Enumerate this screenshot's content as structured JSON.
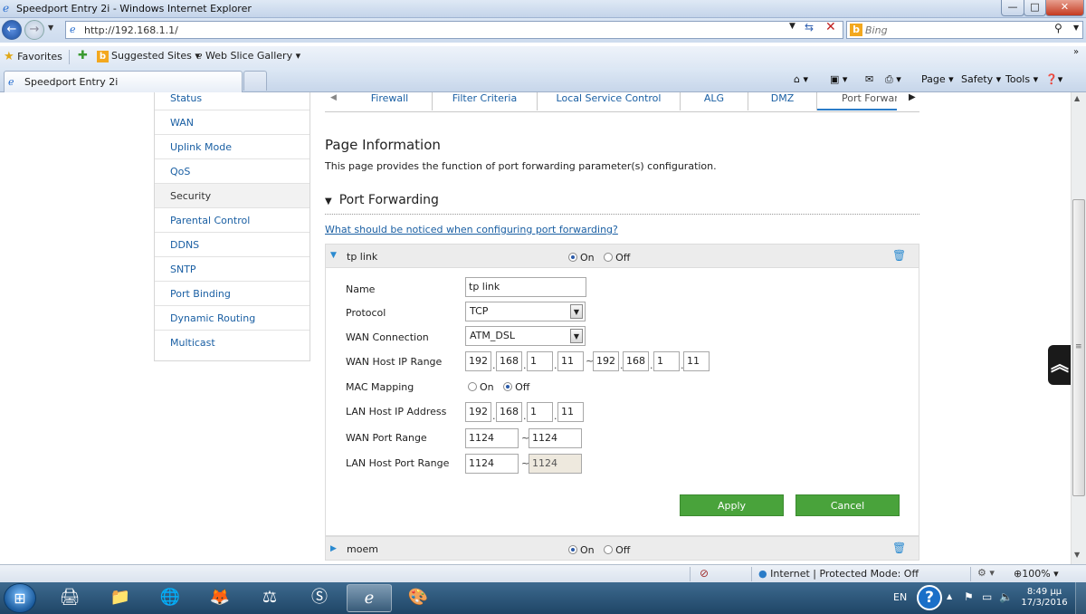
{
  "window": {
    "title": "Speedport Entry 2i - Windows Internet Explorer",
    "controls": {
      "minimize": "—",
      "maximize": "□",
      "close": "✕"
    }
  },
  "addressbar": {
    "url": "http://192.168.1.1/",
    "search_placeholder": "Bing"
  },
  "favorites": {
    "favorites_label": "Favorites",
    "suggested_label": "Suggested Sites ▾",
    "webslice_label": "Web Slice Gallery ▾"
  },
  "tabs": {
    "active_label": "Speedport Entry 2i"
  },
  "commandbar": {
    "page": "Page ▾",
    "safety": "Safety ▾",
    "tools": "Tools ▾"
  },
  "sidebar": {
    "items": [
      {
        "label": "Status"
      },
      {
        "label": "WAN"
      },
      {
        "label": "Uplink Mode"
      },
      {
        "label": "QoS"
      },
      {
        "label": "Security"
      },
      {
        "label": "Parental Control"
      },
      {
        "label": "DDNS"
      },
      {
        "label": "SNTP"
      },
      {
        "label": "Port Binding"
      },
      {
        "label": "Dynamic Routing"
      },
      {
        "label": "Multicast"
      }
    ],
    "active_index": 4
  },
  "subtabs": {
    "items": [
      {
        "label": "Firewall"
      },
      {
        "label": "Filter Criteria"
      },
      {
        "label": "Local Service Control"
      },
      {
        "label": "ALG"
      },
      {
        "label": "DMZ"
      },
      {
        "label": "Port Forwarc"
      }
    ],
    "active_index": 5
  },
  "page": {
    "title": "Page Information",
    "description": "This page provides the function of port forwarding parameter(s) configuration.",
    "section_title": "Port Forwarding",
    "help_link": "What should be noticed when configuring port forwarding?"
  },
  "rules": [
    {
      "name": "tp link",
      "on_label": "On",
      "off_label": "Off",
      "enabled": true,
      "expanded": true,
      "fields": {
        "name_label": "Name",
        "name_value": "tp  link",
        "protocol_label": "Protocol",
        "protocol_value": "TCP",
        "wan_conn_label": "WAN Connection",
        "wan_conn_value": "ATM_DSL",
        "wan_ip_label": "WAN Host IP Range",
        "wan_ip_start": [
          "192",
          "168",
          "1",
          "11"
        ],
        "wan_ip_end": [
          "192",
          "168",
          "1",
          "11"
        ],
        "mac_label": "MAC Mapping",
        "mac_on_label": "On",
        "mac_off_label": "Off",
        "lan_ip_label": "LAN Host IP Address",
        "lan_ip": [
          "192",
          "168",
          "1",
          "11"
        ],
        "wan_port_label": "WAN Port Range",
        "wan_port_start": "1124",
        "wan_port_end": "1124",
        "lan_port_label": "LAN Host Port Range",
        "lan_port_start": "1124",
        "lan_port_end": "1124"
      },
      "apply_label": "Apply",
      "cancel_label": "Cancel"
    },
    {
      "name": "moem",
      "on_label": "On",
      "off_label": "Off",
      "enabled": true,
      "expanded": false
    }
  ],
  "statusbar": {
    "zone": "Internet | Protected Mode: Off",
    "zoom": "100%"
  },
  "taskbar": {
    "language": "EN",
    "time": "8:49 μμ",
    "date": "17/3/2016"
  },
  "colors": {
    "accent_green": "#49a33b",
    "link_blue": "#1a5fa3"
  }
}
